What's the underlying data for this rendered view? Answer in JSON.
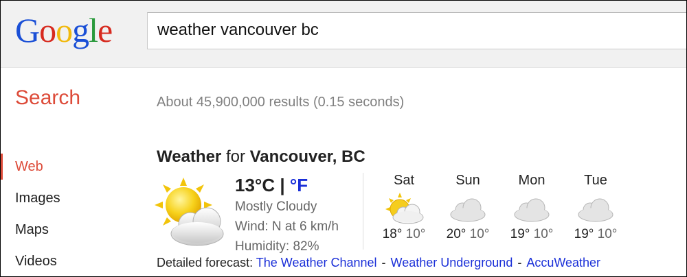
{
  "header": {
    "logo_letters": [
      "G",
      "o",
      "o",
      "g",
      "l",
      "e"
    ],
    "query": "weather vancouver bc"
  },
  "page": {
    "section_title": "Search",
    "result_stats": "About 45,900,000 results (0.15 seconds)"
  },
  "sidebar": {
    "items": [
      {
        "label": "Web",
        "active": true
      },
      {
        "label": "Images",
        "active": false
      },
      {
        "label": "Maps",
        "active": false
      },
      {
        "label": "Videos",
        "active": false
      }
    ]
  },
  "weather": {
    "title_bold": "Weather",
    "title_for": "for",
    "location": "Vancouver, BC",
    "current": {
      "temp": "13°C",
      "separator": "|",
      "alt_unit": "°F",
      "condition": "Mostly Cloudy",
      "wind": "Wind: N at 6 km/h",
      "humidity": "Humidity: 82%",
      "icon": "partly-sunny-icon"
    },
    "forecast": [
      {
        "day": "Sat",
        "high": "18°",
        "low": "10°",
        "icon": "partly-sunny-icon"
      },
      {
        "day": "Sun",
        "high": "20°",
        "low": "10°",
        "icon": "cloudy-icon"
      },
      {
        "day": "Mon",
        "high": "19°",
        "low": "10°",
        "icon": "cloudy-icon"
      },
      {
        "day": "Tue",
        "high": "19°",
        "low": "10°",
        "icon": "cloudy-icon"
      }
    ],
    "detailed_label": "Detailed forecast:",
    "links": [
      "The Weather Channel",
      "Weather Underground",
      "AccuWeather"
    ],
    "link_separator": "-"
  },
  "colors": {
    "accent_red": "#dd4b39",
    "link_blue": "#1a2fd8",
    "header_bg": "#f1f1f1"
  }
}
